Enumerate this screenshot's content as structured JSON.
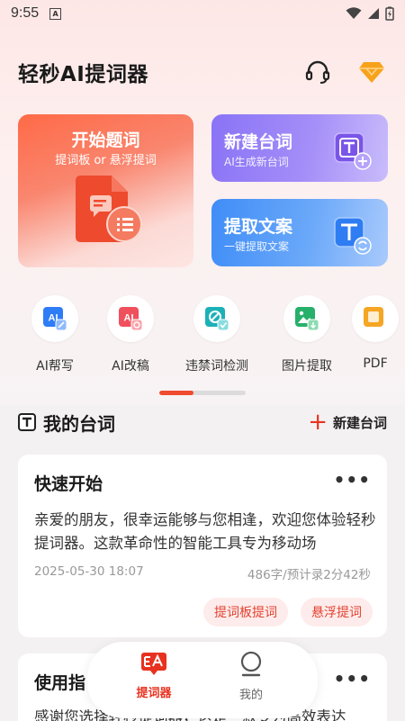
{
  "status": {
    "time": "9:55",
    "notification_glyph": "A"
  },
  "app": {
    "title": "轻秒AI提词器",
    "support_icon": "headset-icon",
    "vip_icon": "diamond-icon"
  },
  "actions": {
    "start": {
      "title": "开始题词",
      "subtitle": "提词板 or 悬浮提词"
    },
    "new_script": {
      "title": "新建台词",
      "subtitle": "AI生成新台词"
    },
    "extract": {
      "title": "提取文案",
      "subtitle": "一键提取文案"
    }
  },
  "tools": [
    {
      "label": "AI帮写",
      "icon": "ai-write-icon",
      "color": "#2e7cf6"
    },
    {
      "label": "AI改稿",
      "icon": "ai-revise-icon",
      "color": "#f0505c"
    },
    {
      "label": "违禁词检测",
      "icon": "banned-word-check-icon",
      "color": "#1bb1b7"
    },
    {
      "label": "图片提取",
      "icon": "image-extract-icon",
      "color": "#27b06a"
    },
    {
      "label": "PDF",
      "icon": "pdf-icon",
      "color": "#f5a623"
    }
  ],
  "tools_scroll_fraction": 0.4,
  "section": {
    "title": "我的台词",
    "new_label": "新建台词"
  },
  "scripts": [
    {
      "title": "快速开始",
      "body": "亲爱的朋友，很幸运能够与您相逢，欢迎您体验轻秒提词器。这款革命性的智能工具专为移动场",
      "date": "2025-05-30 18:07",
      "count": "486字/预计录2分42秒",
      "btn_board": "提词板提词",
      "btn_float": "悬浮提词"
    },
    {
      "title": "使用指",
      "body": "感谢您选择轻秒提词器，这是一款专为高效表达"
    }
  ],
  "tabs": [
    {
      "label": "提词器",
      "active": true
    },
    {
      "label": "我的",
      "active": false
    }
  ],
  "colors": {
    "accent": "#e8321f",
    "pill_bg": "#fdeceb"
  }
}
